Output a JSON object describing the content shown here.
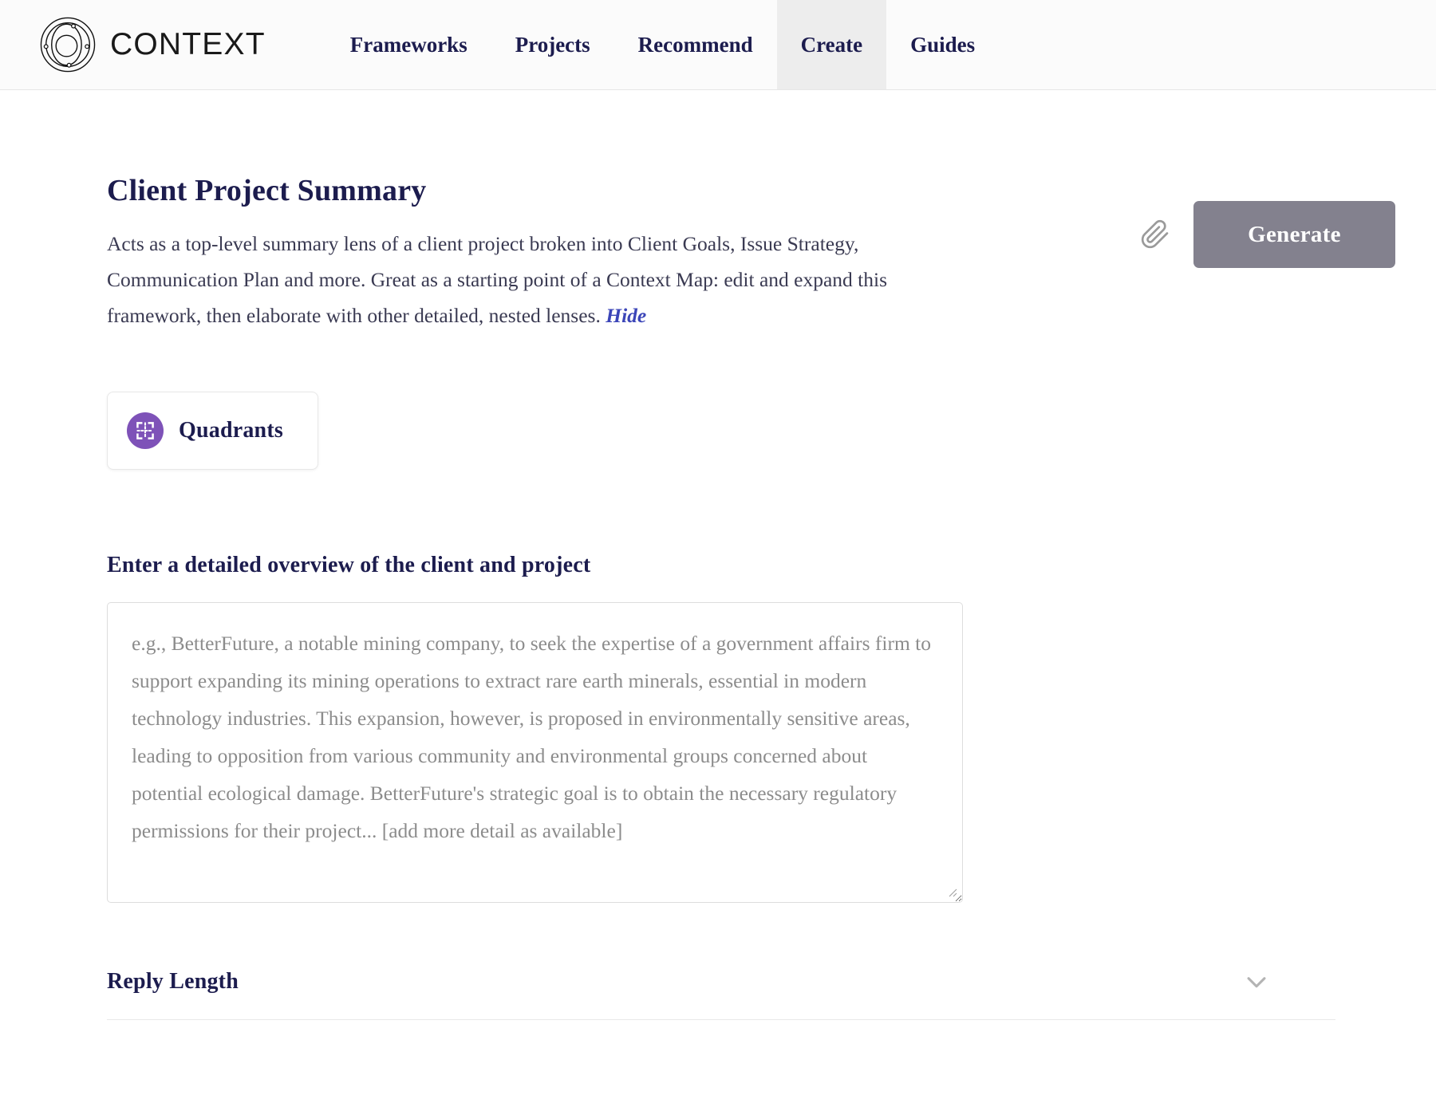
{
  "header": {
    "brand": {
      "name": "CONTEXT",
      "logo_icon": "orbit-logo-icon"
    },
    "nav": [
      {
        "label": "Frameworks",
        "active": false
      },
      {
        "label": "Projects",
        "active": false
      },
      {
        "label": "Recommend",
        "active": false
      },
      {
        "label": "Create",
        "active": true
      },
      {
        "label": "Guides",
        "active": false
      }
    ]
  },
  "main": {
    "title": "Client Project Summary",
    "description_text": "Acts as a top-level summary lens of a client project broken into Client Goals, Issue Strategy, Communication Plan and more. Great as a starting point of a Context Map: edit and expand this framework, then elaborate with other detailed, nested lenses. ",
    "hide_label": "Hide",
    "attach_icon": "paperclip-icon",
    "generate_label": "Generate",
    "chip": {
      "label": "Quadrants",
      "icon": "quadrants-icon"
    },
    "field": {
      "label": "Enter a detailed overview of the client and project",
      "value": "",
      "placeholder": "e.g., BetterFuture, a notable mining company, to seek the expertise of a government affairs firm to support expanding its mining operations to extract rare earth minerals, essential in modern technology industries. This expansion, however, is proposed in environmentally sensitive areas, leading to opposition from various community and environmental groups concerned about potential ecological damage. BetterFuture's strategic goal is to obtain the necessary regulatory permissions for their project... [add more detail as available]"
    },
    "reply_length": {
      "title": "Reply Length",
      "chevron_icon": "chevron-down-icon"
    }
  },
  "colors": {
    "brand_navy": "#1c1c4e",
    "link_blue": "#3b45b8",
    "generate_gray": "#83818e",
    "chip_purple": "#7e52b8",
    "active_tab_bg": "#ededed"
  }
}
